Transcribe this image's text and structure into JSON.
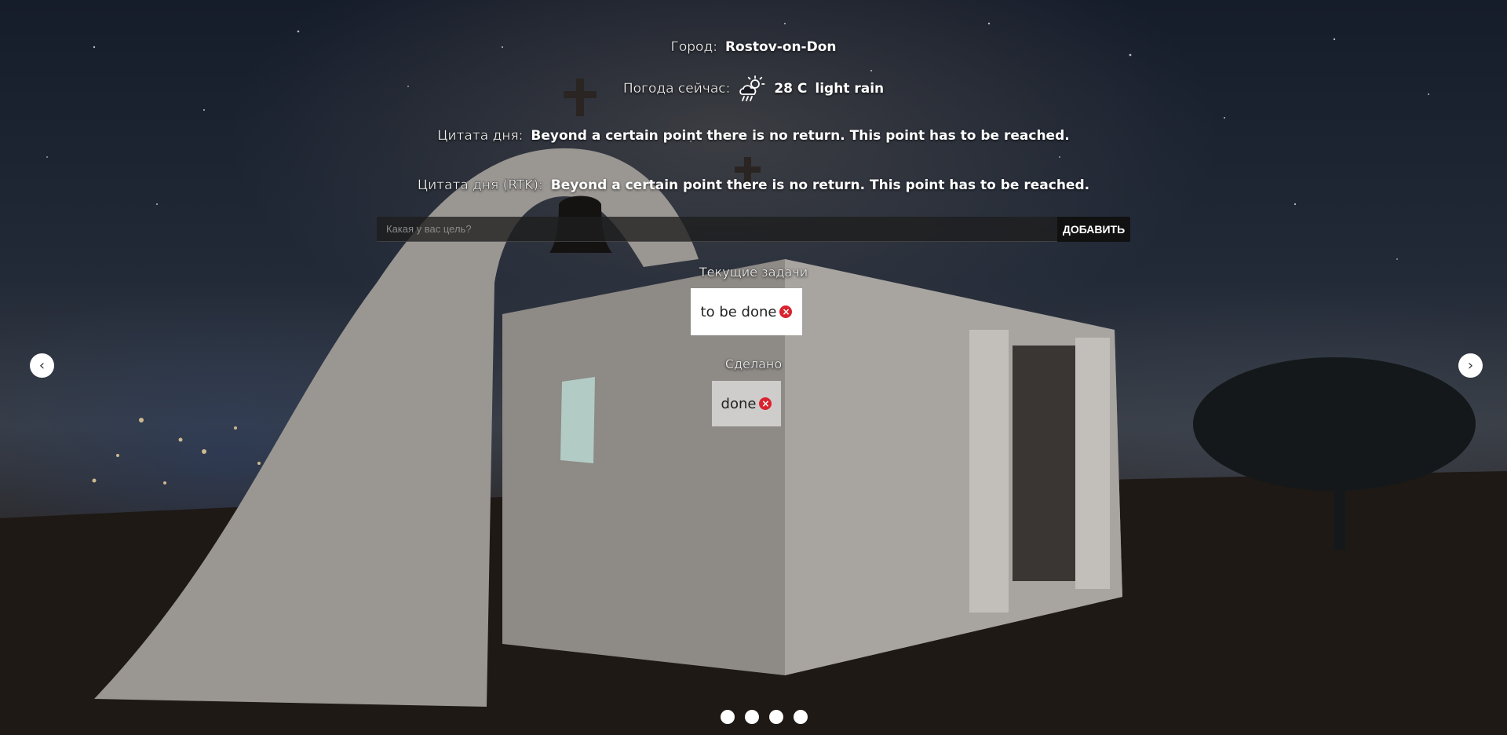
{
  "weather": {
    "city_label": "Город:",
    "city_value": "Rostov-on-Don",
    "now_label": "Погода сейчас:",
    "icon": "rain-cloud-icon",
    "temperature": "28 C",
    "description": "light rain"
  },
  "quotes": {
    "day_label": "Цитата дня:",
    "day_text": "Beyond a certain point there is no return. This point has to be reached.",
    "rtk_label": "Цитата дня (RTK):",
    "rtk_text": "Beyond a certain point there is no return. This point has to be reached."
  },
  "goal_form": {
    "placeholder": "Какая у вас цель?",
    "value": "",
    "add_label": "ДОБАВИТЬ"
  },
  "tasks": {
    "current_title": "Текущие задачи",
    "current_items": [
      "to be done"
    ],
    "done_title": "Сделано",
    "done_items": [
      "done"
    ],
    "delete_glyph": "×"
  },
  "navigation": {
    "prev_glyph": "‹",
    "next_glyph": "›",
    "slide_count": 4
  },
  "colors": {
    "delete_red": "#d9232f",
    "button_black": "#111111"
  }
}
